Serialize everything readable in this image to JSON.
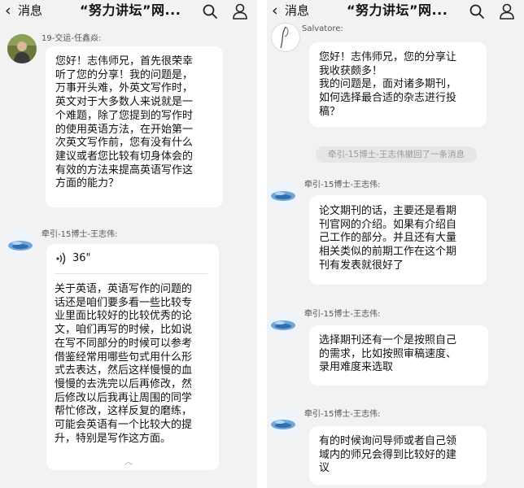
{
  "left": {
    "header": {
      "back_label": "消息",
      "title": "“努力讲坛”网..."
    },
    "messages": [
      {
        "sender": "19-交运-任鑫焱:",
        "lines": [
          "您好！志伟师兄，首先很荣幸",
          "听了您的分享！我的问题是，",
          "万事开头难，外英文写作时，",
          "英文对于大多数人来说就是一",
          "个难题，除了您提到的写作时",
          "的使用英语方法，在开始第一",
          "次英文写作前，您有没有什么",
          "建议或者您比较有切身体会的",
          "有效的方法来提高英语写作这",
          "方面的能力？"
        ]
      },
      {
        "sender": "牵引-15博士-王志伟:",
        "voice_duration": "36\"",
        "lines": [
          "关于英语，英语写作的问题的",
          "话还是咱们要多看一些比较专",
          "业里面比较好的比较优秀的论",
          "文，咱们再写的时候，比如说",
          "在写不同部分的时候可以参考",
          "借鉴经常用哪些句式用什么形",
          "式去表达，然后这样慢慢的血",
          "慢慢的去洗完以后再修改，然",
          "后修改以后我再让周围的同学",
          "帮忙修改，这样反复的磨练，",
          "可能会英语有一个比较大的提",
          "升，特别是写作这方面。"
        ]
      }
    ]
  },
  "right": {
    "header": {
      "back_label": "消息",
      "title": "“努力讲坛”网..."
    },
    "messages": [
      {
        "sender": "Salvatore:",
        "lines": [
          "您好！志伟师兄，您的分享让",
          "我收获颇多！",
          "我的问题是，面对诸多期刊，",
          "如何选择最合适的杂志进行投",
          "稿？"
        ]
      },
      {
        "sender": "牵引-15博士-王志伟:",
        "lines": [
          "论文期刊的话，主要还是看期",
          "刊官网的介绍。如果有介绍自",
          "己工作的部分。并且还有大量",
          "相关类似的前期工作在这个期",
          "刊有发表就很好了"
        ]
      },
      {
        "sender": "牵引-15博士-王志伟:",
        "lines": [
          "选择期刊还有一个是按照自己",
          "的需求，比如按照审稿速度、",
          "录用难度来选取"
        ]
      },
      {
        "sender": "牵引-15博士-王志伟:",
        "lines": [
          "有的时候询问导师或者自己领",
          "域内的师兄会得到比较好的建",
          "议"
        ]
      }
    ],
    "recall_notice": "牵引-15博士-王志伟撤回了一条消息"
  },
  "icons": {
    "back": "chevron-left-icon",
    "search": "search-icon",
    "profile": "person-icon",
    "voice": "voice-wave-icon",
    "collapse": "chevron-up-icon"
  }
}
